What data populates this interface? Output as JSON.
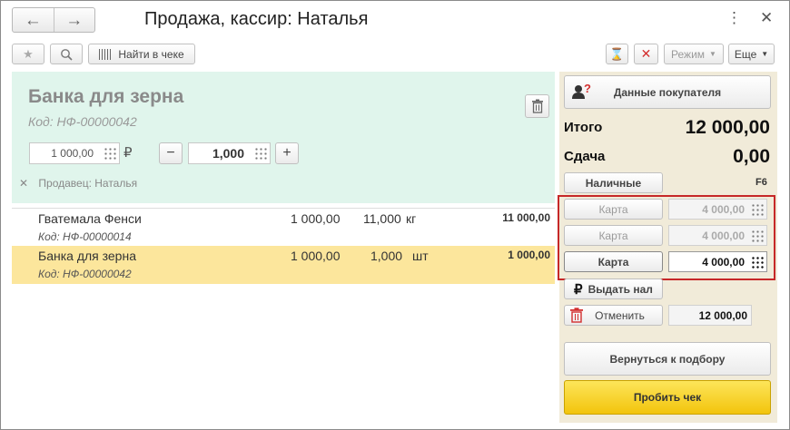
{
  "window": {
    "title": "Продажа, кассир: Наталья",
    "back_icon": "arrow-left-icon",
    "forward_icon": "arrow-right-icon",
    "more_icon": "more-vertical-icon",
    "close_icon": "close-icon"
  },
  "toolbar": {
    "find_in_check_label": "Найти в чеке",
    "mode_label": "Режим",
    "more_label": "Еще"
  },
  "current_item": {
    "name": "Банка для зерна",
    "code": "Код: НФ-00000042",
    "price": "1 000,00",
    "currency_symbol": "₽",
    "quantity": "1,000",
    "seller": "Продавец: Наталья"
  },
  "receipt": {
    "rows": [
      {
        "name": "Гватемала Фенси",
        "code": "Код: НФ-00000014",
        "price": "1 000,00",
        "qty": "11,000",
        "unit": "кг",
        "total": "11 000,00",
        "selected": false
      },
      {
        "name": "Банка для зерна",
        "code": "Код: НФ-00000042",
        "price": "1 000,00",
        "qty": "1,000",
        "unit": "шт",
        "total": "1 000,00",
        "selected": true
      }
    ]
  },
  "payment": {
    "buyer_data_label": "Данные покупателя",
    "total_label": "Итого",
    "total_value": "12 000,00",
    "change_label": "Сдача",
    "change_value": "0,00",
    "cash_label": "Наличные",
    "cash_hotkey": "F6",
    "cards": [
      {
        "label": "Карта",
        "amount": "4 000,00",
        "active": false
      },
      {
        "label": "Карта",
        "amount": "4 000,00",
        "active": false
      },
      {
        "label": "Карта",
        "amount": "4 000,00",
        "active": true
      }
    ],
    "issue_cash_label": "Выдать нал",
    "cancel_label": "Отменить",
    "cancel_amount": "12 000,00",
    "return_label": "Вернуться к подбору",
    "print_check_label": "Пробить чек"
  },
  "colors": {
    "item_panel_bg": "#e0f5ec",
    "selected_row_bg": "#fce69c",
    "right_panel_bg": "#f1ebd9",
    "highlight_border": "#c62828",
    "primary_button": "#f5cc1c"
  }
}
